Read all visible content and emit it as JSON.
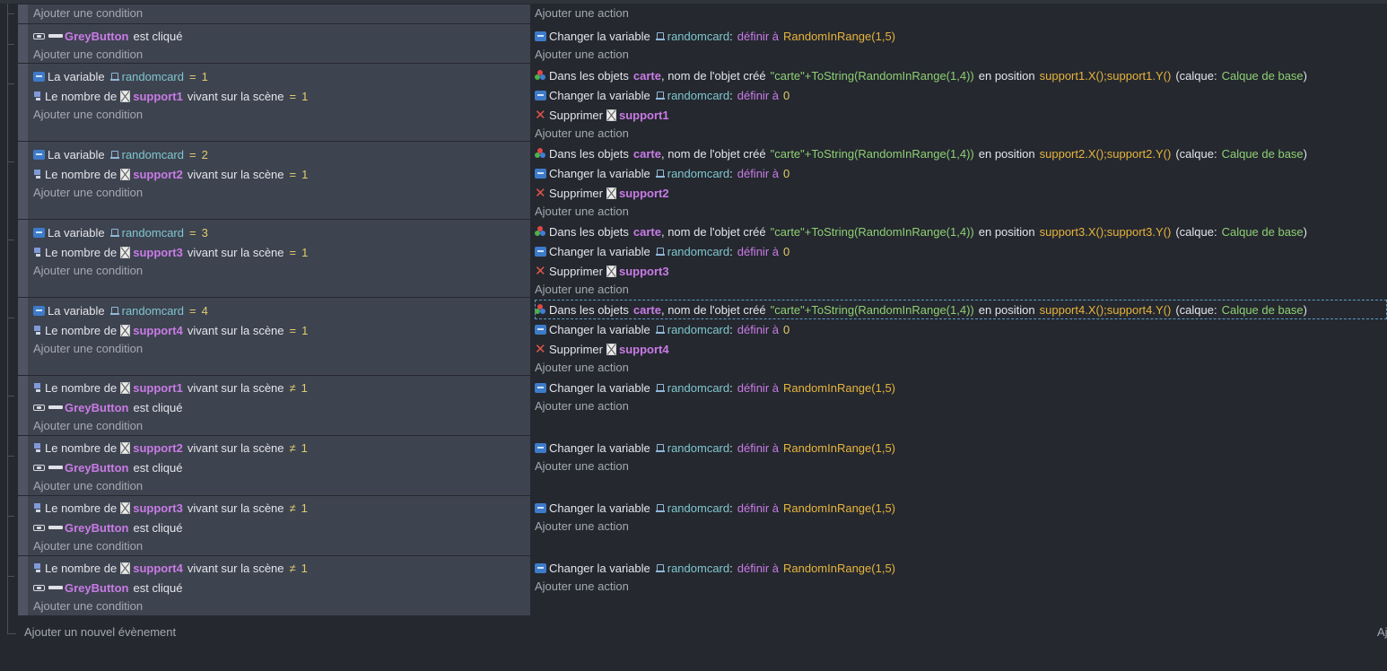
{
  "labels": {
    "add_condition": "Ajouter une condition",
    "add_action": "Ajouter une action",
    "add_event": "Ajouter un nouvel évènement",
    "add_right_cut": "Aj",
    "is_clicked": "est cliqué",
    "change_var": "Changer la variable",
    "define_to": "définir à",
    "the_variable": "La variable",
    "number_of": "Le nombre de",
    "alive_on_scene": "vivant sur la scène",
    "in_objects": "Dans les objets",
    "obj_name_created": ", nom de l'objet créé",
    "in_position": "en position",
    "layer_open": "(calque:",
    "layer_close": ")",
    "delete": "Supprimer",
    "colon": ":"
  },
  "names": {
    "greybutton": "GreyButton",
    "randomcard": "randomcard",
    "carte": "carte",
    "random15": "RandomInRange(1,5)",
    "carte_expr_a": "\"carte\"",
    "carte_expr_b": "+ToString(RandomInRange(1,4))",
    "base_layer": "Calque de base",
    "eq": "=",
    "neq": "≠",
    "zero": "0",
    "one": "1"
  },
  "events": [
    {
      "kind": "empty"
    },
    {
      "kind": "click_set"
    },
    {
      "kind": "var_spawn",
      "value": "1",
      "support": "support1",
      "pos": "support1.X();support1.Y()"
    },
    {
      "kind": "var_spawn",
      "value": "2",
      "support": "support2",
      "pos": "support2.X();support2.Y()"
    },
    {
      "kind": "var_spawn",
      "value": "3",
      "support": "support3",
      "pos": "support3.X();support3.Y()"
    },
    {
      "kind": "var_spawn",
      "value": "4",
      "support": "support4",
      "pos": "support4.X();support4.Y()"
    },
    {
      "kind": "count_click",
      "support": "support1"
    },
    {
      "kind": "count_click",
      "support": "support2"
    },
    {
      "kind": "count_click",
      "support": "support3"
    },
    {
      "kind": "count_click",
      "support": "support4"
    }
  ],
  "colors": {
    "background": "#25282f",
    "condition_panel": "#3e4350",
    "object_name": "#c97be6",
    "variable_name": "#7fc6ce",
    "number": "#dfcd6b",
    "expression": "#e6b43c",
    "literal": "#8ecf73"
  }
}
